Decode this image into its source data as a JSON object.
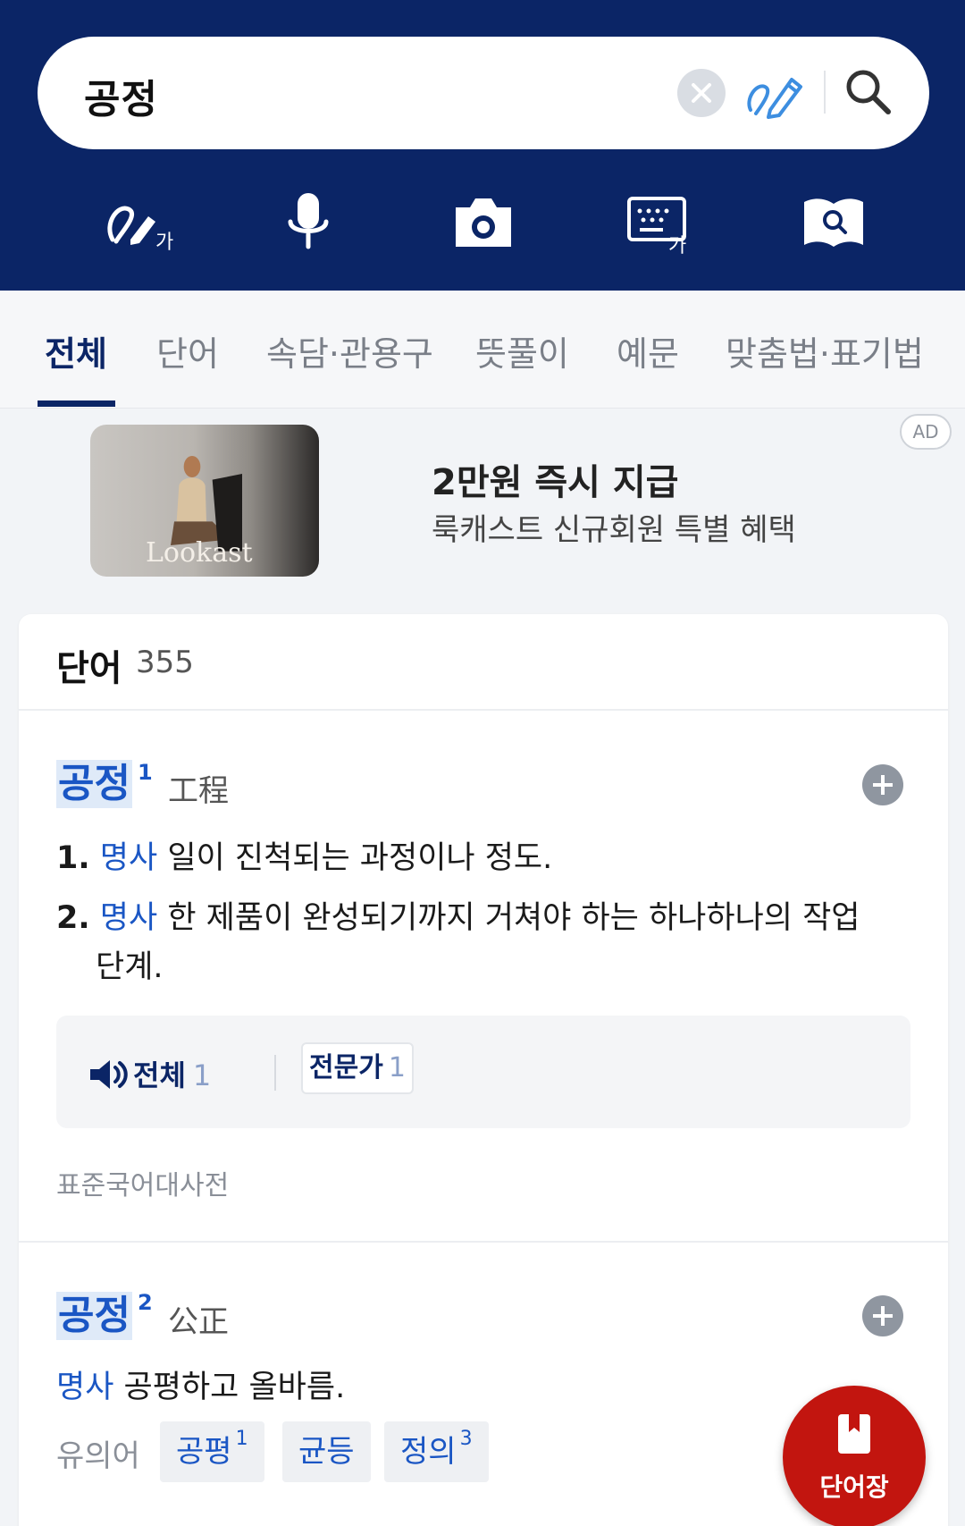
{
  "search": {
    "query": "공정"
  },
  "tabs": [
    {
      "label": "전체",
      "active": true
    },
    {
      "label": "단어"
    },
    {
      "label": "속담·관용구"
    },
    {
      "label": "뜻풀이"
    },
    {
      "label": "예문"
    },
    {
      "label": "맞춤법·표기법"
    }
  ],
  "ad": {
    "brand": "Lookast",
    "title": "2만원 즉시 지급",
    "subtitle": "룩캐스트 신규회원 특별 혜택",
    "badge": "AD"
  },
  "words_section": {
    "title": "단어",
    "count": "355"
  },
  "entries": [
    {
      "word": "공정",
      "sup": "1",
      "hanja": "工程",
      "definitions": [
        {
          "num": "1.",
          "pos": "명사",
          "text": "일이 진척되는 과정이나 정도."
        },
        {
          "num": "2.",
          "pos": "명사",
          "text": "한 제품이 완성되기까지 거쳐야 하는 하나하나의 작업",
          "text_cont": "단계."
        }
      ],
      "audio": {
        "all_label": "전체",
        "all_count": "1",
        "expert_label": "전문가",
        "expert_count": "1"
      },
      "source": "표준국어대사전"
    },
    {
      "word": "공정",
      "sup": "2",
      "hanja": "公正",
      "definitions": [
        {
          "pos": "명사",
          "text": "공평하고 올바름."
        }
      ],
      "synonyms_label": "유의어",
      "synonyms": [
        {
          "word": "공평",
          "sup": "1"
        },
        {
          "word": "균등",
          "sup": ""
        },
        {
          "word": "정의",
          "sup": "3"
        }
      ]
    }
  ],
  "fab": {
    "label": "단어장"
  },
  "colors": {
    "header": "#0b2566",
    "accent": "#1a56c4",
    "fab": "#c2150f"
  }
}
